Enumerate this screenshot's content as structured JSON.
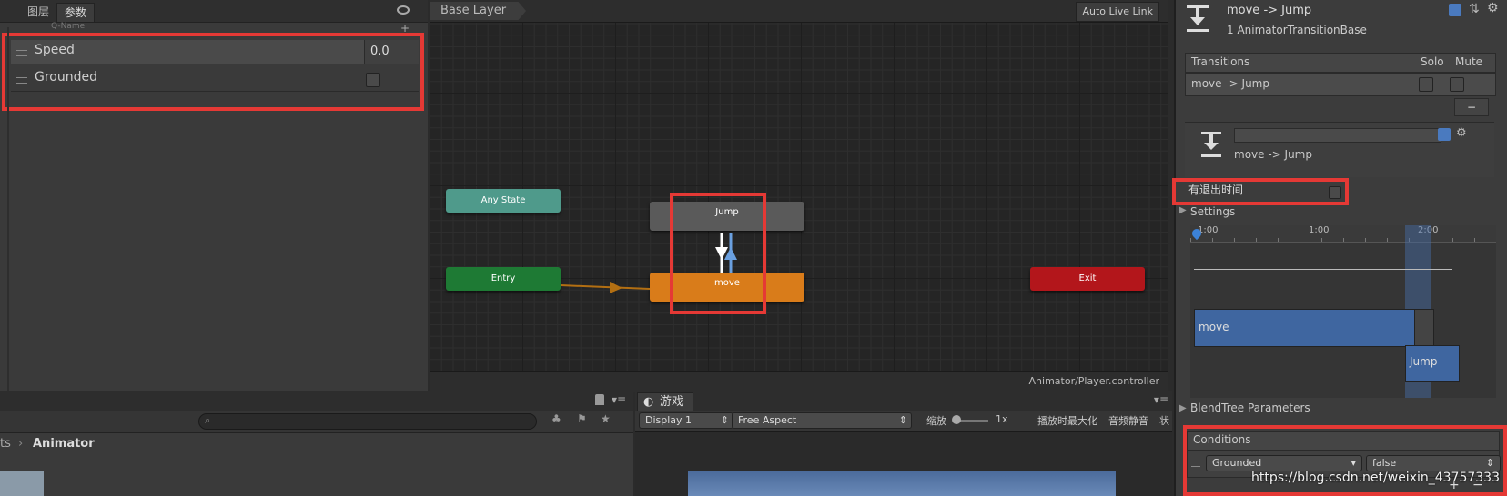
{
  "left": {
    "tabs": [
      "图层",
      "参数"
    ],
    "search_placeholder": "Q-Name",
    "params": [
      {
        "name": "Speed",
        "value": "0.0"
      },
      {
        "name": "Grounded",
        "checked": false
      }
    ]
  },
  "graph": {
    "breadcrumb": "Base Layer",
    "auto_live_link": "Auto Live Link",
    "nodes": {
      "any_state": "Any State",
      "entry": "Entry",
      "jump": "Jump",
      "move": "move",
      "exit": "Exit"
    },
    "footer_path": "Animator/Player.controller"
  },
  "inspector": {
    "title": "move -> Jump",
    "subtitle": "1 AnimatorTransitionBase",
    "transitions_header": "Transitions",
    "solo": "Solo",
    "mute": "Mute",
    "transition_item": "move -> Jump",
    "minus": "−",
    "transition_name": "move -> Jump",
    "has_exit_time_label": "有退出时间",
    "settings_label": "Settings",
    "timeline_ticks": [
      "1:00",
      "1:00",
      "2:00"
    ],
    "clip_move": "move",
    "clip_jump": "Jump",
    "blendtree_label": "BlendTree Parameters",
    "conditions_header": "Conditions",
    "condition_param": "Grounded",
    "condition_value": "false",
    "plus": "+",
    "minus2": "−"
  },
  "bottom": {
    "project_breadcrumb_prefix": "ts",
    "project_breadcrumb": "Animator",
    "game_tab": "游戏",
    "display": "Display 1",
    "aspect": "Free Aspect",
    "scale_label": "缩放",
    "scale_value": "1x",
    "maximize": "播放时最大化",
    "mute_audio": "音频静音",
    "stats": "状"
  },
  "watermark": "https://blog.csdn.net/weixin_43757333",
  "colors": {
    "red_highlight": "#e53935",
    "entry": "#1e7a34",
    "any_state": "#4f9a8b",
    "move": "#d97c1a",
    "exit": "#b3161b",
    "jump": "#5a5a5a"
  }
}
